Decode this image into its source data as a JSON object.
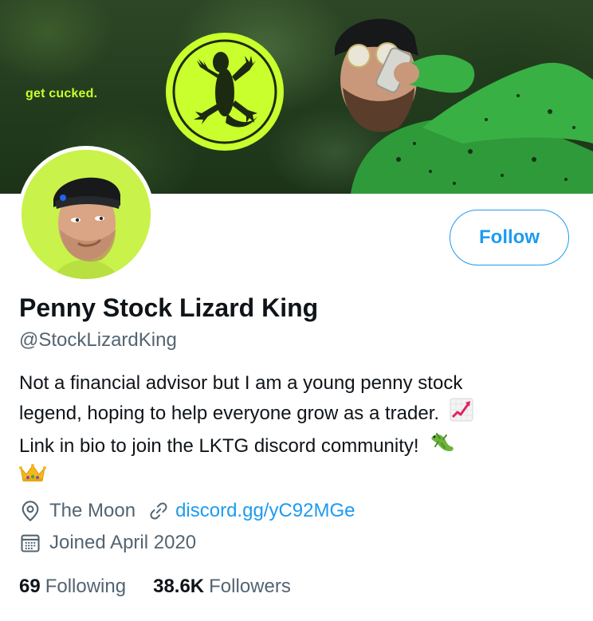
{
  "banner": {
    "tagline": "get cucked."
  },
  "profile": {
    "display_name": "Penny Stock Lizard King",
    "handle": "@StockLizardKing",
    "bio": {
      "line1": "Not a financial advisor but I am a young penny stock",
      "line2": "legend, hoping to help everyone grow as a trader.",
      "line3": "Link in bio to join the LKTG discord community!"
    },
    "bio_emojis": [
      "chart-increasing-icon",
      "lizard-icon",
      "crown-icon"
    ],
    "location": "The Moon",
    "website": "discord.gg/yC92MGe",
    "joined": "Joined April 2020",
    "follow_label": "Follow"
  },
  "stats": {
    "following_count": "69",
    "following_label": "Following",
    "followers_count": "38.6K",
    "followers_label": "Followers"
  },
  "colors": {
    "accent": "#1d9bf0",
    "secondary_text": "#536471",
    "brand_lime": "#c8ff2c"
  }
}
